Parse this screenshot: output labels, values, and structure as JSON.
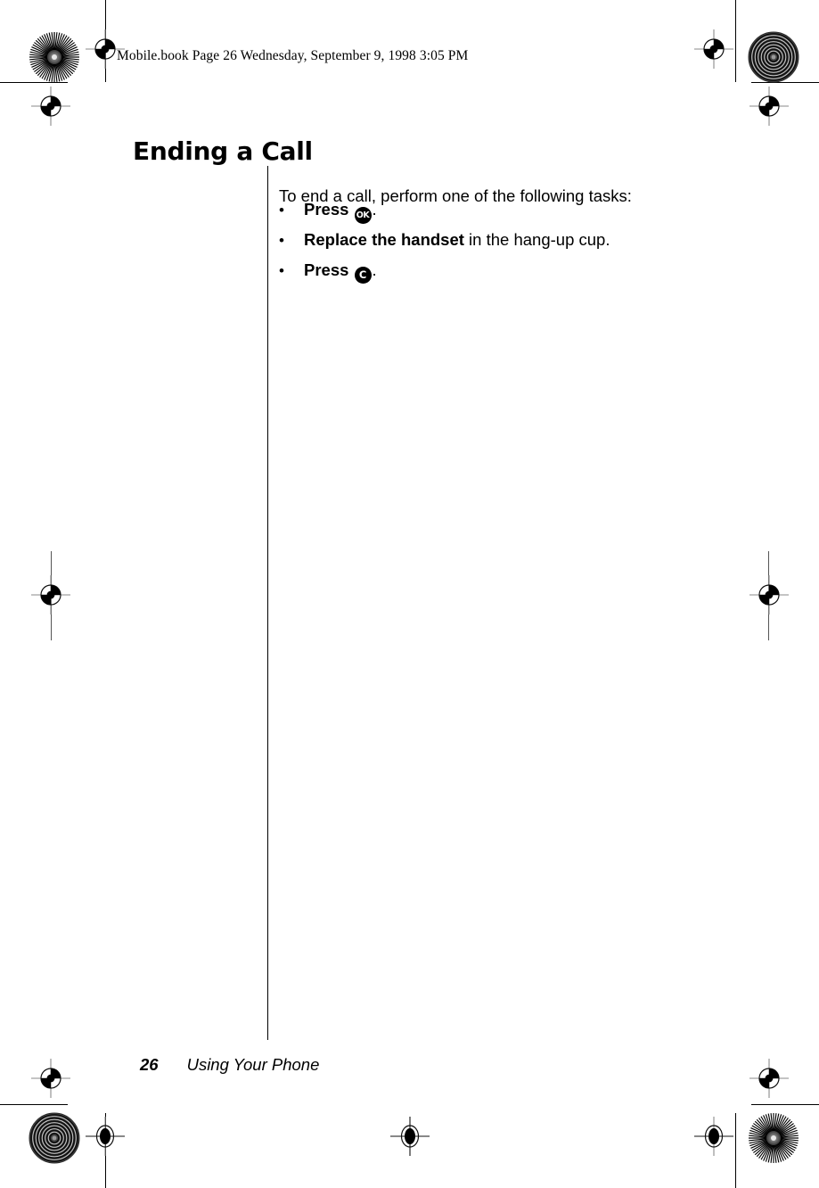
{
  "document": {
    "slug_line": "Mobile.book  Page 26  Wednesday, September 9, 1998  3:05 PM",
    "chapter_title": "Ending a Call",
    "intro_paragraph": "To end a call, perform one of the following tasks:",
    "bullets": [
      {
        "marker": "•",
        "lead_bold": "Press",
        "key_icon": "ok-key-icon",
        "key_label": "OK",
        "trailing": ".",
        "rest": ""
      },
      {
        "marker": "•",
        "lead_bold": "Replace the handset",
        "key_icon": "",
        "key_label": "",
        "trailing": "",
        "rest": " in the hang-up cup."
      },
      {
        "marker": "•",
        "lead_bold": "Press",
        "key_icon": "clear-key-icon",
        "key_label": "C",
        "trailing": ".",
        "rest": ""
      }
    ],
    "footer": {
      "page_number": "26",
      "running_head": "Using Your Phone"
    }
  },
  "print_marks": {
    "registration_mark_name": "registration-target-icon",
    "starburst_patch_name": "starburst-density-patch",
    "concentric_patch_name": "concentric-density-patch",
    "colors": {
      "ink": "#000000",
      "hairline": "#808080",
      "paper": "#ffffff"
    }
  }
}
